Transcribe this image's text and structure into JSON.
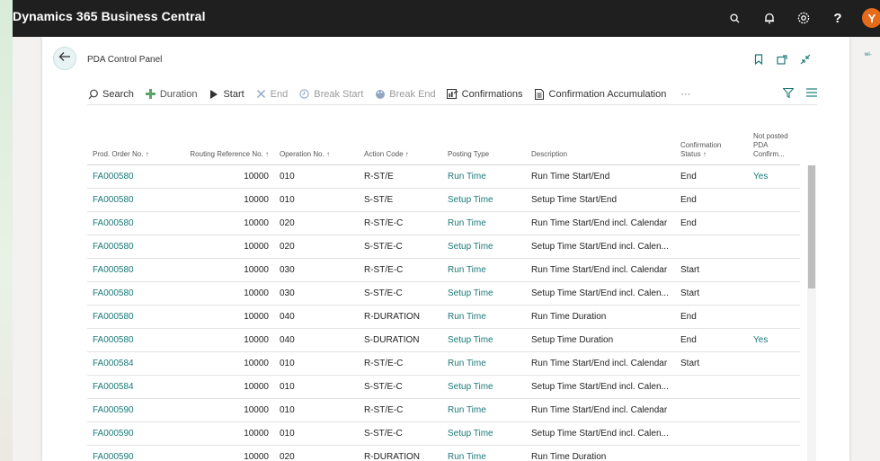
{
  "app": {
    "title": "Dynamics 365 Business Central",
    "avatar_initial": "Y"
  },
  "page": {
    "title": "PDA Control Panel",
    "side_link": "wi-"
  },
  "actions": [
    {
      "label": "Search",
      "icon": "search-icon",
      "enabled": true
    },
    {
      "label": "Duration",
      "icon": "plus-icon",
      "enabled": false
    },
    {
      "label": "Start",
      "icon": "play-icon",
      "enabled": true
    },
    {
      "label": "End",
      "icon": "close-icon",
      "enabled": false
    },
    {
      "label": "Break Start",
      "icon": "clock-icon",
      "enabled": false
    },
    {
      "label": "Break End",
      "icon": "palette-icon",
      "enabled": false
    },
    {
      "label": "Confirmations",
      "icon": "report-icon",
      "enabled": true
    },
    {
      "label": "Confirmation Accumulation",
      "icon": "document-icon",
      "enabled": true
    }
  ],
  "more_label": "···",
  "columns": [
    {
      "label": "Prod. Order No. ↑"
    },
    {
      "label": "Routing Reference No. ↑"
    },
    {
      "label": "Operation No. ↑"
    },
    {
      "label": "Action Code ↑"
    },
    {
      "label": "Posting Type"
    },
    {
      "label": "Description"
    },
    {
      "label": "Confirmation Status ↑"
    },
    {
      "label": "Not posted PDA Confirm..."
    }
  ],
  "rows": [
    [
      "FA000580",
      "10000",
      "010",
      "R-ST/E",
      "Run Time",
      "Run Time Start/End",
      "End",
      "Yes"
    ],
    [
      "FA000580",
      "10000",
      "010",
      "S-ST/E",
      "Setup Time",
      "Setup Time Start/End",
      "End",
      ""
    ],
    [
      "FA000580",
      "10000",
      "020",
      "R-ST/E-C",
      "Run Time",
      "Run Time Start/End incl. Calendar",
      "End",
      ""
    ],
    [
      "FA000580",
      "10000",
      "020",
      "S-ST/E-C",
      "Setup Time",
      "Setup Time Start/End incl. Calen...",
      "",
      ""
    ],
    [
      "FA000580",
      "10000",
      "030",
      "R-ST/E-C",
      "Run Time",
      "Run Time Start/End incl. Calendar",
      "Start",
      ""
    ],
    [
      "FA000580",
      "10000",
      "030",
      "S-ST/E-C",
      "Setup Time",
      "Setup Time Start/End incl. Calen...",
      "Start",
      ""
    ],
    [
      "FA000580",
      "10000",
      "040",
      "R-DURATION",
      "Run Time",
      "Run Time Duration",
      "End",
      ""
    ],
    [
      "FA000580",
      "10000",
      "040",
      "S-DURATION",
      "Setup Time",
      "Setup Time Duration",
      "End",
      "Yes"
    ],
    [
      "FA000584",
      "10000",
      "010",
      "R-ST/E-C",
      "Run Time",
      "Run Time Start/End incl. Calendar",
      "Start",
      ""
    ],
    [
      "FA000584",
      "10000",
      "010",
      "S-ST/E-C",
      "Setup Time",
      "Setup Time Start/End incl. Calen...",
      "",
      ""
    ],
    [
      "FA000590",
      "10000",
      "010",
      "R-ST/E-C",
      "Run Time",
      "Run Time Start/End incl. Calendar",
      "",
      ""
    ],
    [
      "FA000590",
      "10000",
      "010",
      "S-ST/E-C",
      "Setup Time",
      "Setup Time Start/End incl. Calen...",
      "",
      ""
    ],
    [
      "FA000590",
      "10000",
      "020",
      "R-DURATION",
      "Run Time",
      "Run Time Duration",
      "",
      ""
    ]
  ],
  "colors": {
    "accent": "#1b7a78",
    "topbar": "#1f1f1f",
    "avatar": "#e36b1a"
  }
}
